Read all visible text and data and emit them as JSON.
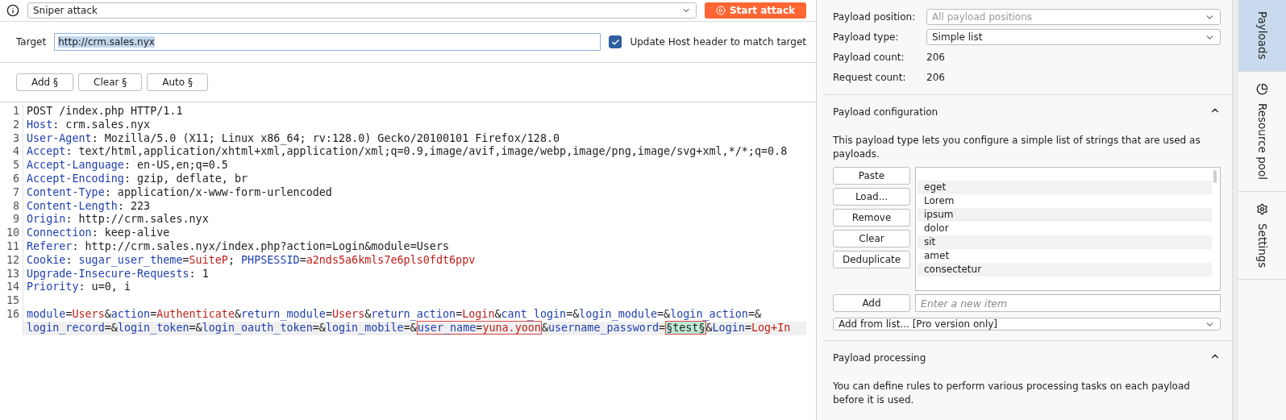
{
  "attack_bar": {
    "attack_type": "Sniper attack",
    "start_button": "Start attack"
  },
  "target": {
    "label": "Target",
    "value": "http://crm.sales.nyx",
    "update_host": {
      "label": "Update Host header to match target",
      "checked": true
    }
  },
  "position_buttons": [
    "Add §",
    "Clear §",
    "Auto §"
  ],
  "request_lines": [
    {
      "number": "1",
      "current": false,
      "segments": [
        {
          "kind": "plain",
          "text": "POST /index.php HTTP/1.1"
        }
      ]
    },
    {
      "number": "2",
      "current": false,
      "segments": [
        {
          "kind": "key",
          "text": "Host"
        },
        {
          "kind": "plain",
          "text": ": crm.sales.nyx"
        }
      ]
    },
    {
      "number": "3",
      "current": false,
      "segments": [
        {
          "kind": "key",
          "text": "User-Agent"
        },
        {
          "kind": "plain",
          "text": ": Mozilla/5.0 (X11; Linux x86_64; rv:128.0) Gecko/20100101 Firefox/128.0"
        }
      ]
    },
    {
      "number": "4",
      "current": false,
      "segments": [
        {
          "kind": "key",
          "text": "Accept"
        },
        {
          "kind": "plain",
          "text": ": text/html,application/xhtml+xml,application/xml;q=0.9,image/avif,image/webp,image/png,image/svg+xml,*/*;q=0.8"
        }
      ]
    },
    {
      "number": "5",
      "current": false,
      "segments": [
        {
          "kind": "key",
          "text": "Accept-Language"
        },
        {
          "kind": "plain",
          "text": ": en-US,en;q=0.5"
        }
      ]
    },
    {
      "number": "6",
      "current": false,
      "segments": [
        {
          "kind": "key",
          "text": "Accept-Encoding"
        },
        {
          "kind": "plain",
          "text": ": gzip, deflate, br"
        }
      ]
    },
    {
      "number": "7",
      "current": false,
      "segments": [
        {
          "kind": "key",
          "text": "Content-Type"
        },
        {
          "kind": "plain",
          "text": ": application/x-www-form-urlencoded"
        }
      ]
    },
    {
      "number": "8",
      "current": false,
      "segments": [
        {
          "kind": "key",
          "text": "Content-Length"
        },
        {
          "kind": "plain",
          "text": ": 223"
        }
      ]
    },
    {
      "number": "9",
      "current": false,
      "segments": [
        {
          "kind": "key",
          "text": "Origin"
        },
        {
          "kind": "plain",
          "text": ": http://crm.sales.nyx"
        }
      ]
    },
    {
      "number": "10",
      "current": false,
      "segments": [
        {
          "kind": "key",
          "text": "Connection"
        },
        {
          "kind": "plain",
          "text": ": keep-alive"
        }
      ]
    },
    {
      "number": "11",
      "current": false,
      "segments": [
        {
          "kind": "key",
          "text": "Referer"
        },
        {
          "kind": "plain",
          "text": ": http://crm.sales.nyx/index.php?action=Login&module=Users"
        }
      ]
    },
    {
      "number": "12",
      "current": false,
      "segments": [
        {
          "kind": "key",
          "text": "Cookie"
        },
        {
          "kind": "plain",
          "text": ": "
        },
        {
          "kind": "key",
          "text": "sugar_user_theme"
        },
        {
          "kind": "plain",
          "text": "="
        },
        {
          "kind": "value",
          "text": "SuiteP"
        },
        {
          "kind": "plain",
          "text": "; "
        },
        {
          "kind": "key",
          "text": "PHPSESSID"
        },
        {
          "kind": "plain",
          "text": "="
        },
        {
          "kind": "value",
          "text": "a2nds5a6kmls7e6pls0fdt6ppv"
        }
      ]
    },
    {
      "number": "13",
      "current": false,
      "segments": [
        {
          "kind": "key",
          "text": "Upgrade-Insecure-Requests"
        },
        {
          "kind": "plain",
          "text": ": 1"
        }
      ]
    },
    {
      "number": "14",
      "current": false,
      "segments": [
        {
          "kind": "key",
          "text": "Priority"
        },
        {
          "kind": "plain",
          "text": ": u=0, i"
        }
      ]
    },
    {
      "number": "15",
      "current": false
    },
    {
      "number": "16",
      "current": false,
      "segments": [
        {
          "kind": "key",
          "text": "module"
        },
        {
          "kind": "plain",
          "text": "="
        },
        {
          "kind": "value",
          "text": "Users"
        },
        {
          "kind": "plain",
          "text": "&"
        },
        {
          "kind": "key",
          "text": "action"
        },
        {
          "kind": "plain",
          "text": "="
        },
        {
          "kind": "value",
          "text": "Authenticate"
        },
        {
          "kind": "plain",
          "text": "&"
        },
        {
          "kind": "key",
          "text": "return_module"
        },
        {
          "kind": "plain",
          "text": "="
        },
        {
          "kind": "value",
          "text": "Users"
        },
        {
          "kind": "plain",
          "text": "&"
        },
        {
          "kind": "key",
          "text": "return_action"
        },
        {
          "kind": "plain",
          "text": "="
        },
        {
          "kind": "value",
          "text": "Login"
        },
        {
          "kind": "plain",
          "text": "&"
        },
        {
          "kind": "key",
          "text": "cant_login"
        },
        {
          "kind": "plain",
          "text": "=&"
        },
        {
          "kind": "key",
          "text": "login_module"
        },
        {
          "kind": "plain",
          "text": "=&"
        },
        {
          "kind": "key",
          "text": "login_action"
        },
        {
          "kind": "plain",
          "text": "=&"
        }
      ]
    },
    {
      "current": true,
      "segments": [
        {
          "kind": "key",
          "text": "login_record"
        },
        {
          "kind": "plain",
          "text": "=&"
        },
        {
          "kind": "key",
          "text": "login_token"
        },
        {
          "kind": "plain",
          "text": "=&"
        },
        {
          "kind": "key",
          "text": "login_oauth_token"
        },
        {
          "kind": "plain",
          "text": "=&"
        },
        {
          "kind": "key",
          "text": "login_mobile"
        },
        {
          "kind": "plain",
          "text": "=&"
        },
        {
          "kind": "box",
          "parts": [
            {
              "kind": "key",
              "text": "user_name"
            },
            {
              "kind": "plain",
              "text": "="
            },
            {
              "kind": "value",
              "text": "yuna.yoon"
            }
          ]
        },
        {
          "kind": "plain",
          "text": "&"
        },
        {
          "kind": "key",
          "text": "username_password"
        },
        {
          "kind": "plain",
          "text": "="
        },
        {
          "kind": "box",
          "parts": [
            {
              "kind": "marker",
              "text": "§test§"
            }
          ]
        },
        {
          "kind": "plain",
          "text": "&"
        },
        {
          "kind": "key",
          "text": "Login"
        },
        {
          "kind": "plain",
          "text": "="
        },
        {
          "kind": "value",
          "text": "Log+In"
        }
      ]
    }
  ],
  "payloads": {
    "fields": [
      {
        "label": "Payload position:",
        "kind": "select",
        "value": "All payload positions",
        "disabled": true
      },
      {
        "label": "Payload type:",
        "kind": "select",
        "value": "Simple list",
        "disabled": false
      },
      {
        "label": "Payload count:",
        "kind": "text",
        "value": "206"
      },
      {
        "label": "Request count:",
        "kind": "text",
        "value": "206"
      }
    ],
    "configuration": {
      "title": "Payload configuration",
      "expanded": true,
      "description": "This payload type lets you configure a simple list of strings that are used as payloads.",
      "buttons": [
        "Paste",
        "Load...",
        "Remove",
        "Clear",
        "Deduplicate"
      ],
      "items": [
        "eget",
        "Lorem",
        "ipsum",
        "dolor",
        "sit",
        "amet",
        "consectetur"
      ],
      "add_button": "Add",
      "add_placeholder": "Enter a new item",
      "add_from_list": "Add from list... [Pro version only]"
    },
    "processing": {
      "title": "Payload processing",
      "expanded": true,
      "description": "You can define rules to perform various processing tasks on each payload before it is used."
    }
  },
  "side_tabs": [
    {
      "label": "Payloads",
      "kind": "none",
      "selected": true
    },
    {
      "label": "Resource pool",
      "kind": "pie",
      "selected": false
    },
    {
      "label": "Settings",
      "kind": "gear",
      "selected": false
    }
  ]
}
